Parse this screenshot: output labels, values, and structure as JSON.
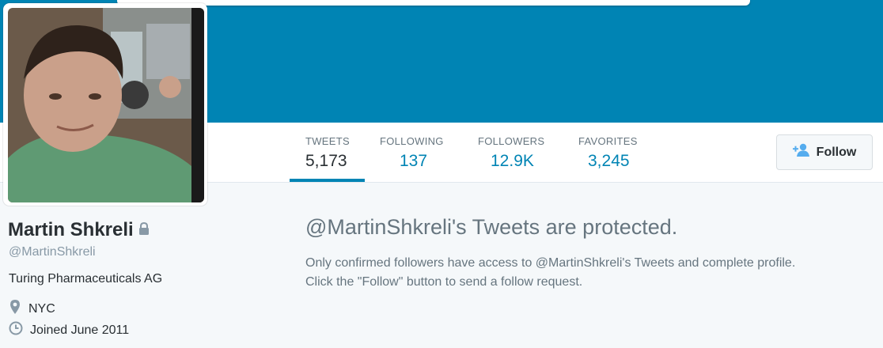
{
  "profile": {
    "name": "Martin Shkreli",
    "handle": "@MartinShkreli",
    "bio": "Turing Pharmaceuticals AG",
    "location": "NYC",
    "joined": "Joined June 2011"
  },
  "stats": [
    {
      "label": "TWEETS",
      "value": "5,173"
    },
    {
      "label": "FOLLOWING",
      "value": "137"
    },
    {
      "label": "FOLLOWERS",
      "value": "12.9K"
    },
    {
      "label": "FAVORITES",
      "value": "3,245"
    }
  ],
  "follow_button": {
    "label": "Follow"
  },
  "protected": {
    "title": "@MartinShkreli's Tweets are protected.",
    "line1": "Only confirmed followers have access to @MartinShkreli's Tweets and complete profile.",
    "line2": "Click the \"Follow\" button to send a follow request."
  },
  "colors": {
    "accent": "#0084b4",
    "header": "#0084b4",
    "muted": "#66757f"
  },
  "icons": {
    "lock": "lock-icon",
    "location": "location-pin-icon",
    "calendar": "clock-icon",
    "follow": "add-user-icon"
  }
}
